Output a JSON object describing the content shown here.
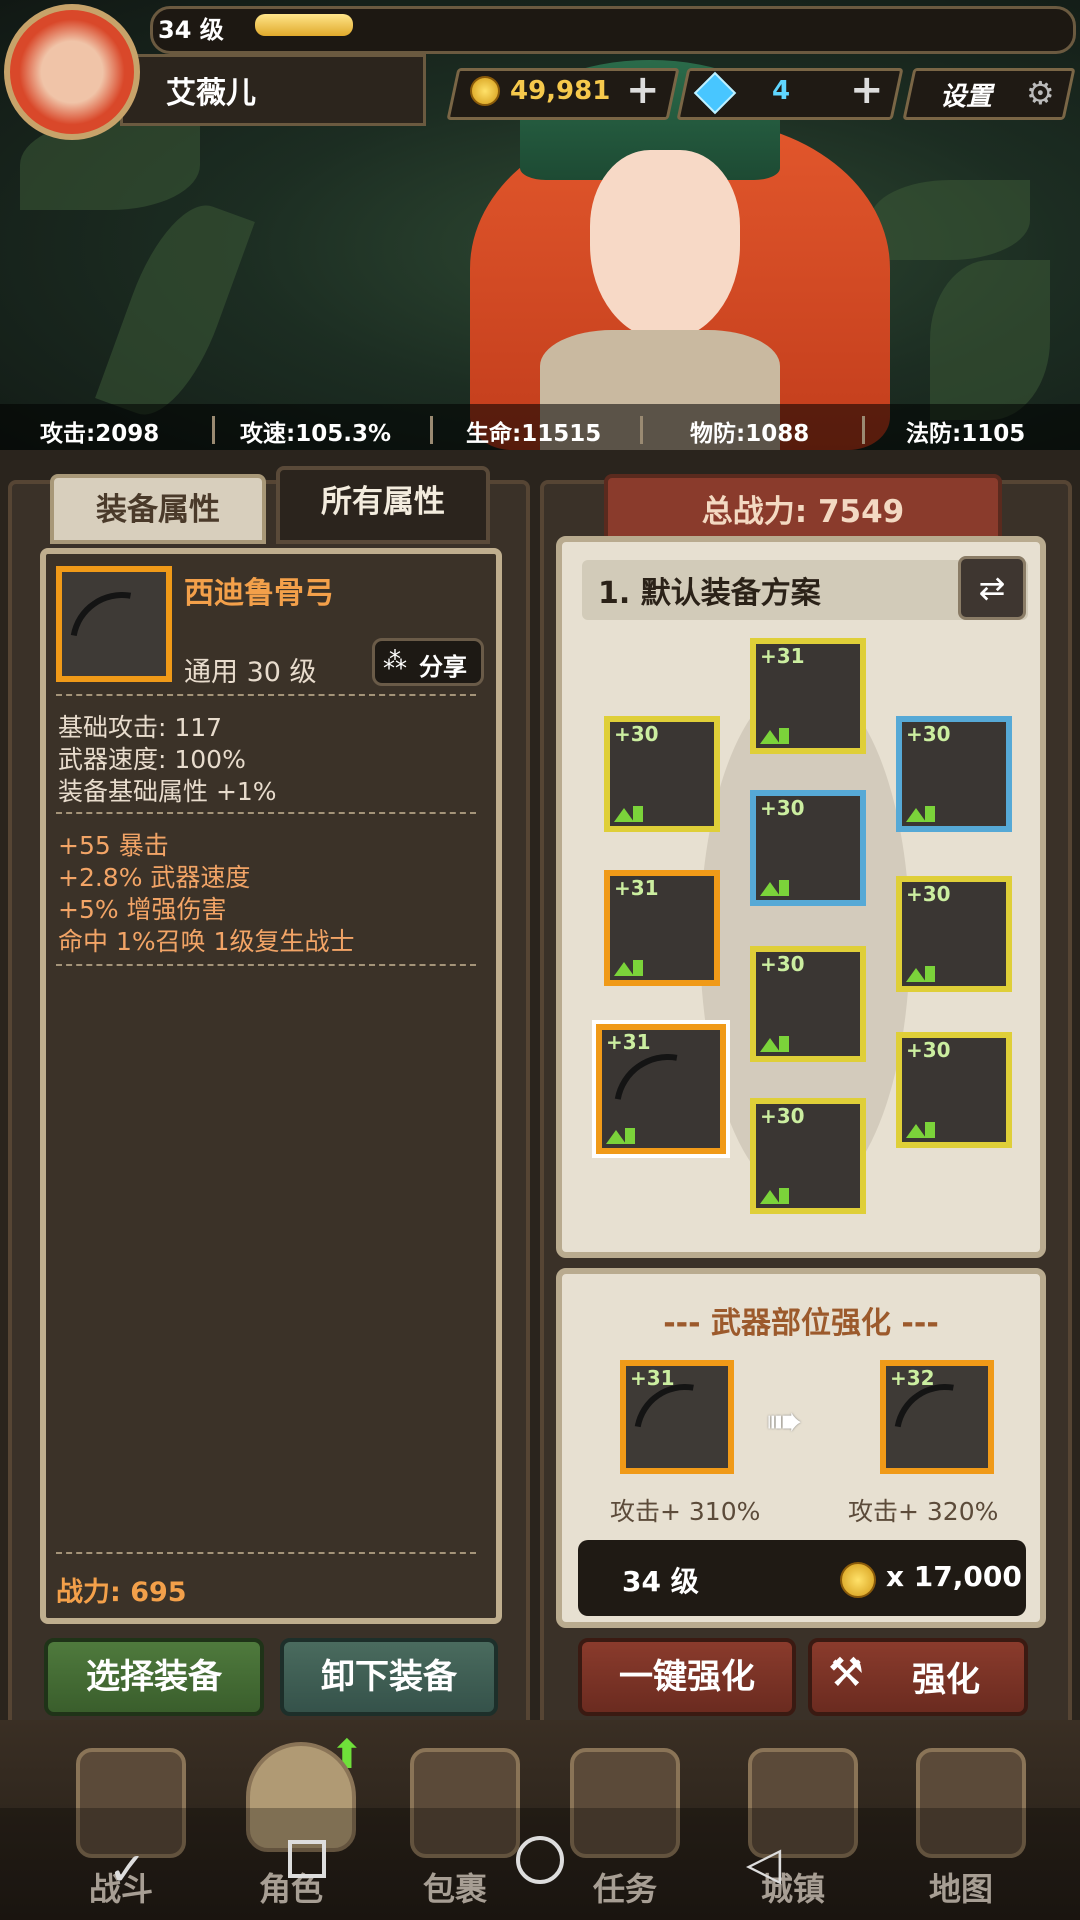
{
  "player": {
    "level": "34 级",
    "name": "艾薇儿",
    "level_progress": 0.12
  },
  "resources": {
    "gold": "49,981",
    "diamonds": "4",
    "settings_label": "设置"
  },
  "stats": [
    {
      "label": "攻击:2098"
    },
    {
      "label": "攻速:105.3%"
    },
    {
      "label": "生命:11515"
    },
    {
      "label": "物防:1088"
    },
    {
      "label": "法防:1105"
    }
  ],
  "left_tabs": {
    "equip_attr": "装备属性",
    "all_attr": "所有属性"
  },
  "item": {
    "name": "西迪鲁骨弓",
    "type_level": "通用 30 级",
    "share_label": "分享",
    "base_lines": [
      "基础攻击:  117",
      "武器速度:  100%",
      "装备基础属性 +1%"
    ],
    "bonus_lines": [
      "+55 暴击",
      "+2.8% 武器速度",
      "+5% 增强伤害",
      "命中 1%召唤 1级复生战士"
    ],
    "power": "战力:  695"
  },
  "left_buttons": {
    "select": "选择装备",
    "unequip": "卸下装备"
  },
  "right": {
    "total_power": "总战力:  7549",
    "plan": "1. 默认装备方案",
    "slots": [
      {
        "level": "+31"
      },
      {
        "level": "+30"
      },
      {
        "level": "+30"
      },
      {
        "level": "+30"
      },
      {
        "level": "+31"
      },
      {
        "level": "+30"
      },
      {
        "level": "+30"
      },
      {
        "level": "+31"
      },
      {
        "level": "+30"
      },
      {
        "level": "+30"
      }
    ]
  },
  "upgrade": {
    "title": "--- 武器部位强化 ---",
    "from_level": "+31",
    "to_level": "+32",
    "from_attack": "攻击+ 310%",
    "to_attack": "攻击+ 320%",
    "req_level": "34 级",
    "cost": "x 17,000",
    "one_key": "一键强化",
    "enhance": "强化"
  },
  "nav": [
    {
      "label": "战斗"
    },
    {
      "label": "角色"
    },
    {
      "label": "包裹"
    },
    {
      "label": "任务"
    },
    {
      "label": "城镇"
    },
    {
      "label": "地图"
    }
  ]
}
